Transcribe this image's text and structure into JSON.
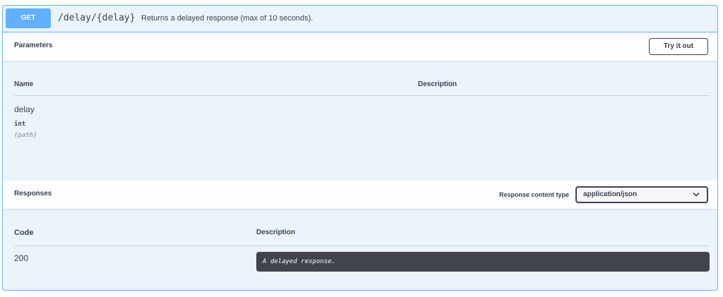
{
  "operation": {
    "method": "GET",
    "path": "/delay/{delay}",
    "summary": "Returns a delayed response (max of 10 seconds)."
  },
  "parameters": {
    "title": "Parameters",
    "try_button": "Try it out",
    "columns": {
      "name": "Name",
      "description": "Description"
    },
    "items": [
      {
        "name": "delay",
        "type": "int",
        "in": "(path)"
      }
    ]
  },
  "responses": {
    "title": "Responses",
    "content_type_label": "Response content type",
    "content_type_value": "application/json",
    "columns": {
      "code": "Code",
      "description": "Description"
    },
    "items": [
      {
        "code": "200",
        "description": "A delayed response."
      }
    ]
  },
  "colors": {
    "get_accent": "#61affe",
    "panel_bg": "#ebf3fb",
    "text": "#3b4151",
    "dark_box": "#41444e"
  },
  "icons": {
    "select_arrow": "chevron-down-icon"
  }
}
